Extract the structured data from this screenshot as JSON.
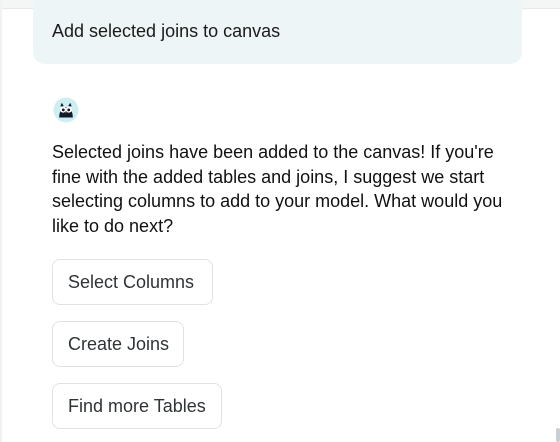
{
  "chat": {
    "user_message": "Add selected joins to canvas",
    "assistant_avatar_icon": "owl-bot-avatar-icon",
    "assistant_message": "Selected joins have been added to the canvas! If you're fine with the added tables and joins, I suggest we start selecting columns to add to your model. What would you like to do next?",
    "actions": [
      {
        "label": "Select Columns"
      },
      {
        "label": "Create Joins"
      },
      {
        "label": "Find more Tables"
      }
    ]
  },
  "colors": {
    "user_bubble_bg": "#eef5f6",
    "button_border": "#dfe3e6",
    "avatar_bg": "#cfeef2",
    "avatar_dark": "#0f1a2a"
  }
}
